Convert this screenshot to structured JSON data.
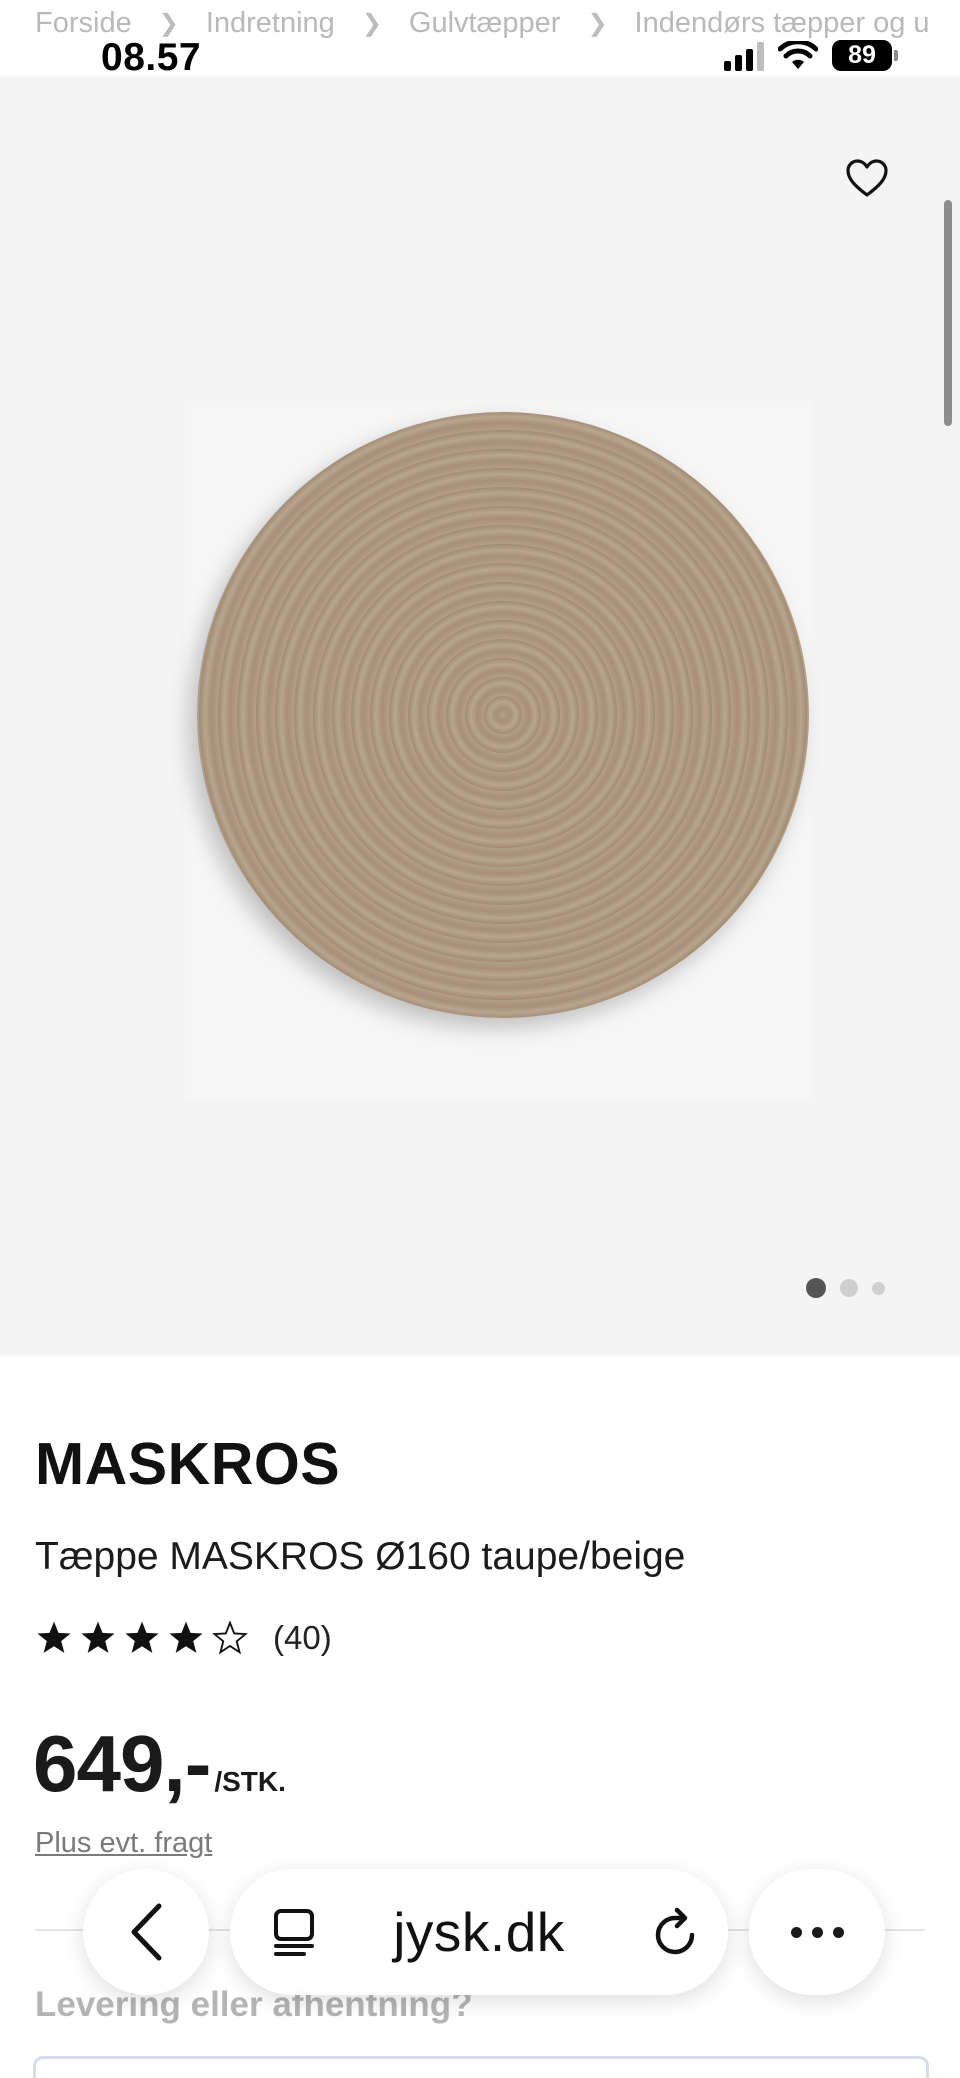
{
  "breadcrumb": {
    "items": [
      "Forside",
      "Indretning",
      "Gulvtæpper",
      "Indendørs tæpper og u"
    ]
  },
  "status_bar": {
    "time": "08.57",
    "battery": "89"
  },
  "gallery": {
    "slide_count": 3,
    "active_slide": 1
  },
  "product": {
    "brand": "MASKROS",
    "name": "Tæppe MASKROS Ø160 taupe/beige",
    "rating": 4,
    "rating_max": 5,
    "review_count": "(40)",
    "price": "649,-",
    "unit": "/STK.",
    "shipping_link": "Plus evt. fragt"
  },
  "delivery": {
    "heading": "Levering eller afhentning?"
  },
  "browser": {
    "url": "jysk.dk"
  },
  "icons": {
    "favorite": "heart-outline-icon",
    "back": "chevron-left-icon",
    "tabs": "tabs-icon",
    "reload": "reload-icon",
    "more": "more-icon",
    "star_filled": "star-filled-icon",
    "star_empty": "star-outline-icon"
  },
  "colors": {
    "gallery_bg": "#f4f4f4",
    "rug": "#ab9580",
    "muted_text": "#b4b4b4"
  }
}
